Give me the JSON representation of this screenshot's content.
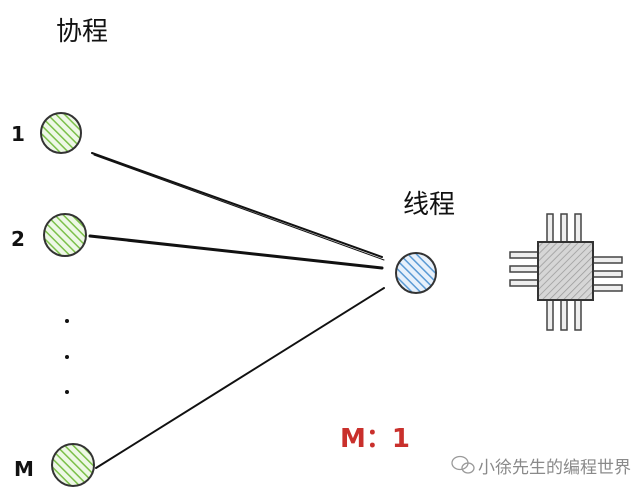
{
  "diagram": {
    "coroutine_label": "协程",
    "thread_label": "线程",
    "coroutine_nodes": [
      "1",
      "2",
      "M"
    ],
    "ellipsis": "· · ·",
    "ratio_label": "M：1",
    "watermark": "小徐先生的编程世界",
    "colors": {
      "coroutine_fill": "#9bd26b",
      "coroutine_stroke": "#3a3a3a",
      "thread_fill": "#6ea8dc",
      "cpu_body": "#d0d0d0",
      "ratio": "#c9302c",
      "line": "#111111"
    }
  }
}
